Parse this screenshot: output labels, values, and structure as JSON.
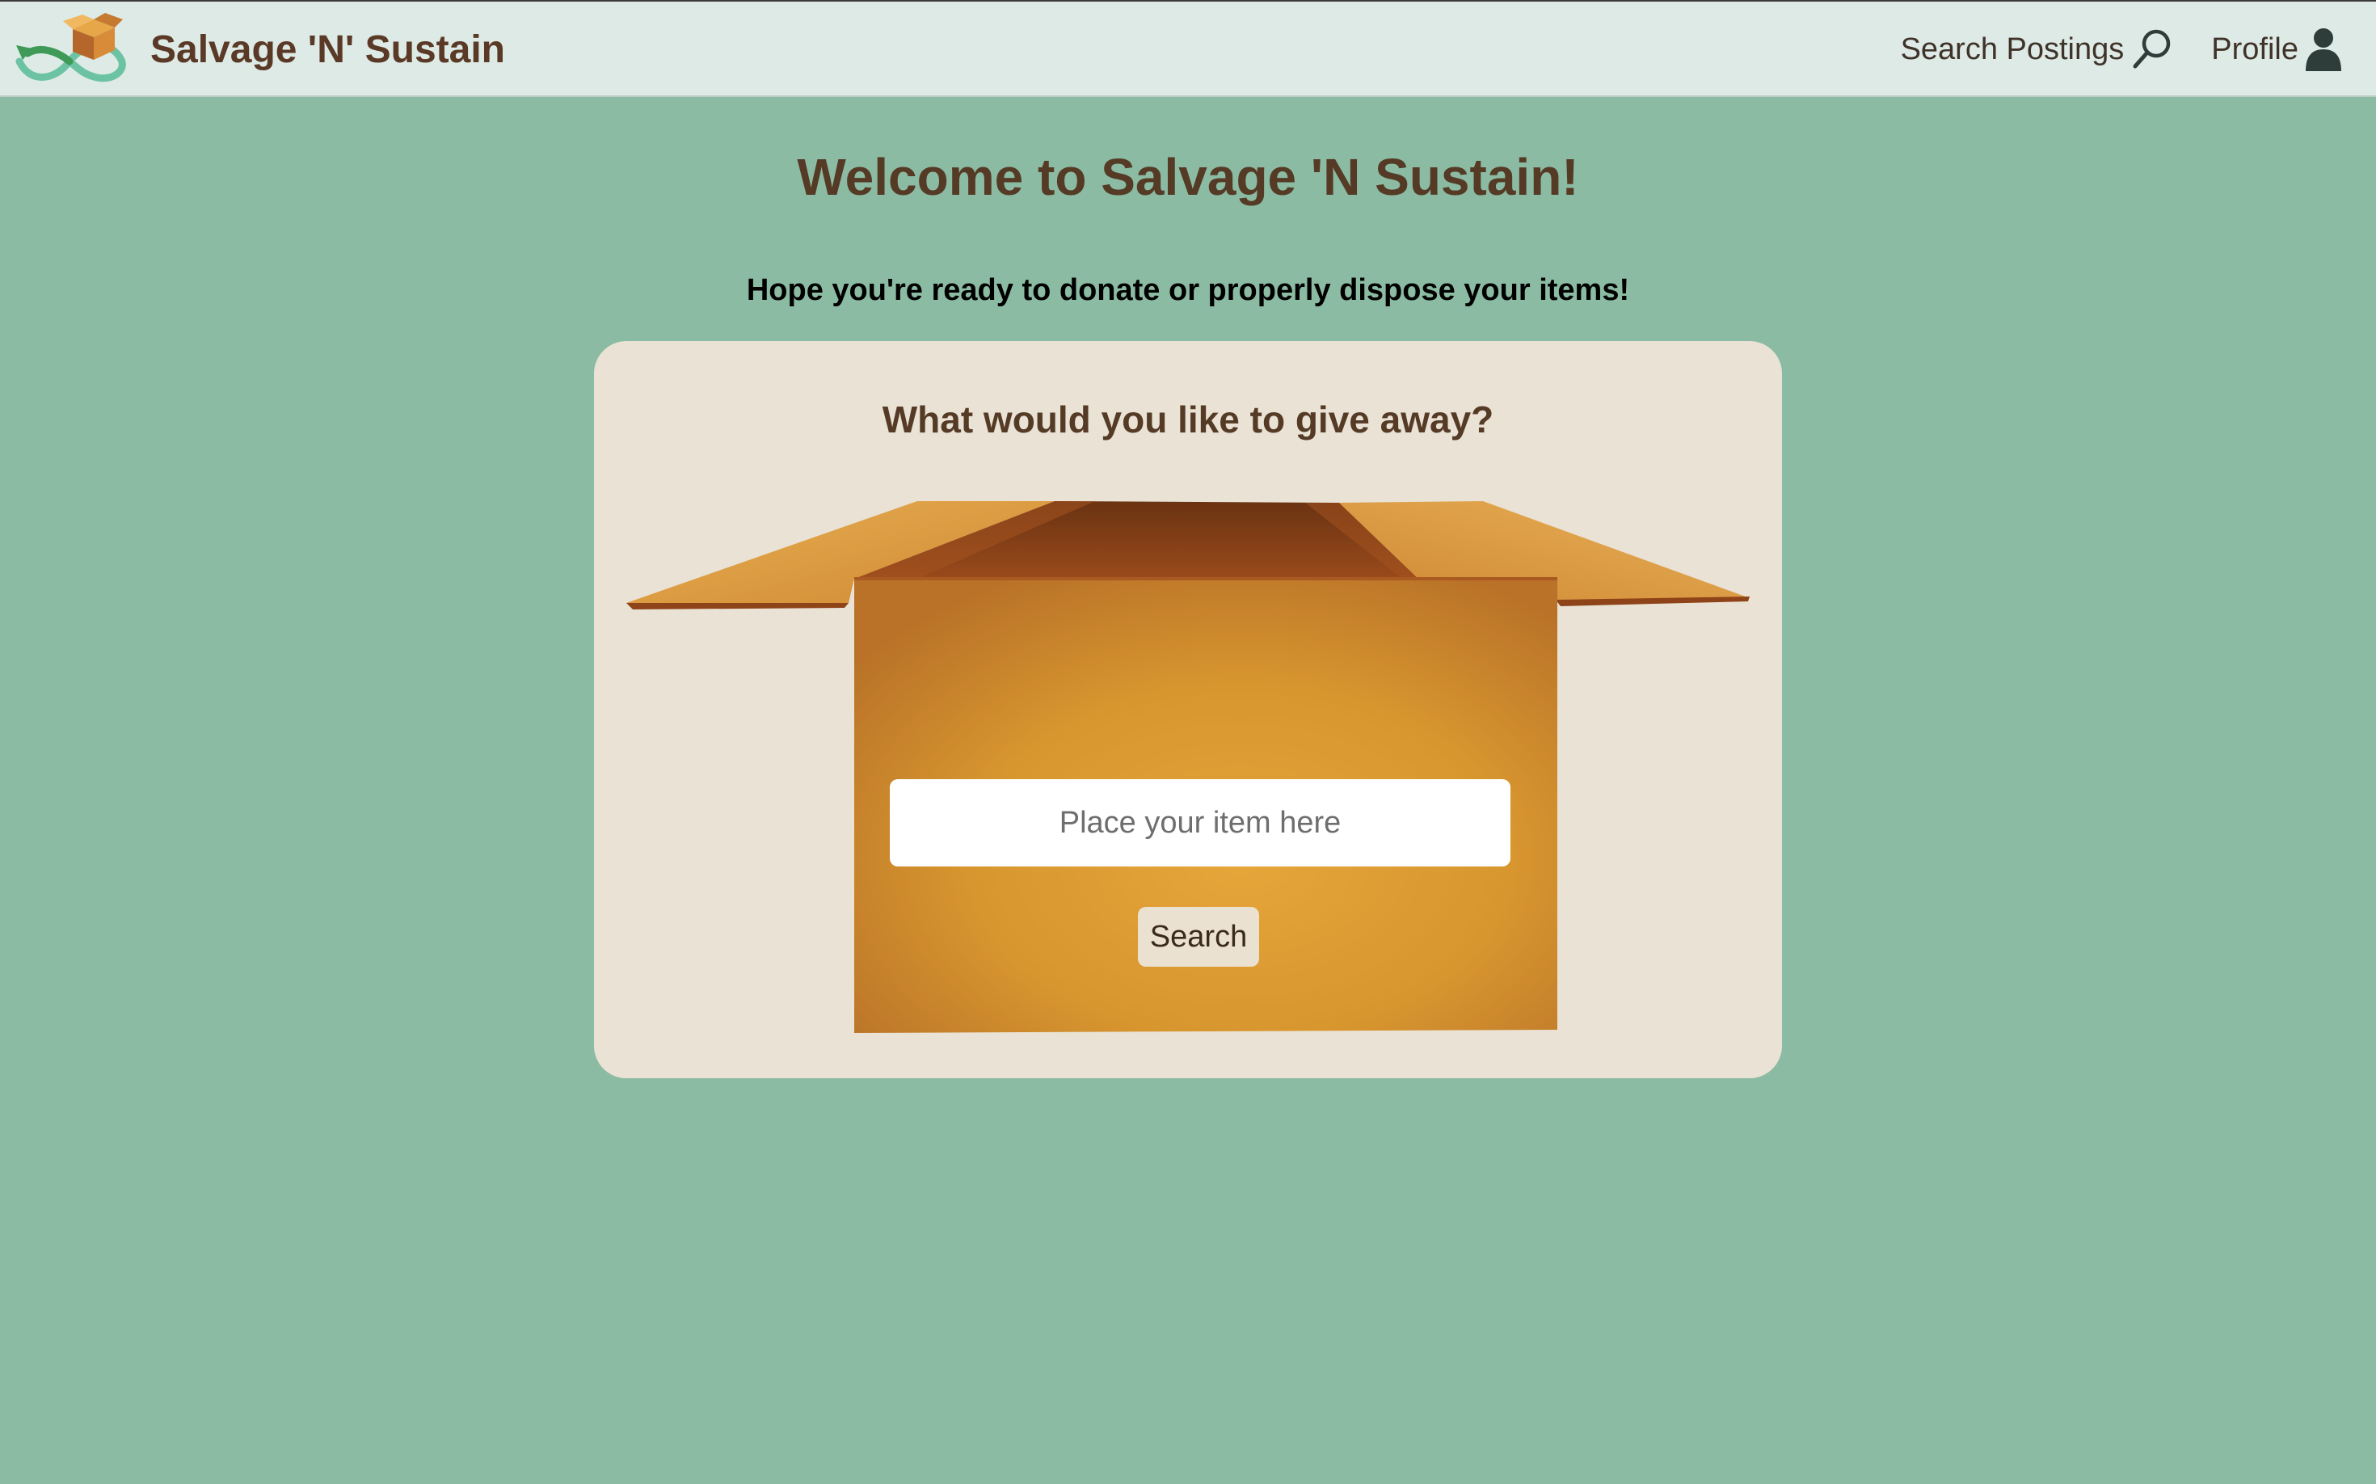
{
  "navbar": {
    "brand_name": "Salvage 'N' Sustain",
    "logo_icon": "recycle-box-logo-icon",
    "links": [
      {
        "label": "Search Postings",
        "icon": "magnifier-icon"
      },
      {
        "label": "Profile",
        "icon": "user-icon"
      }
    ]
  },
  "main": {
    "welcome": "Welcome to Salvage 'N Sustain!",
    "subtitle": "Hope you're ready to donate or properly dispose your items!",
    "card": {
      "title": "What would you like to give away?",
      "input_placeholder": "Place your item here",
      "input_value": "",
      "search_label": "Search",
      "illustration_icon": "open-cardboard-box"
    }
  },
  "colors": {
    "page_bg": "#8bbba2",
    "navbar_bg": "#deeae6",
    "card_bg": "#e9e2d5",
    "heading": "#553a26",
    "box_body": "#d9942f",
    "box_flap_shadow": "#8f4318"
  }
}
